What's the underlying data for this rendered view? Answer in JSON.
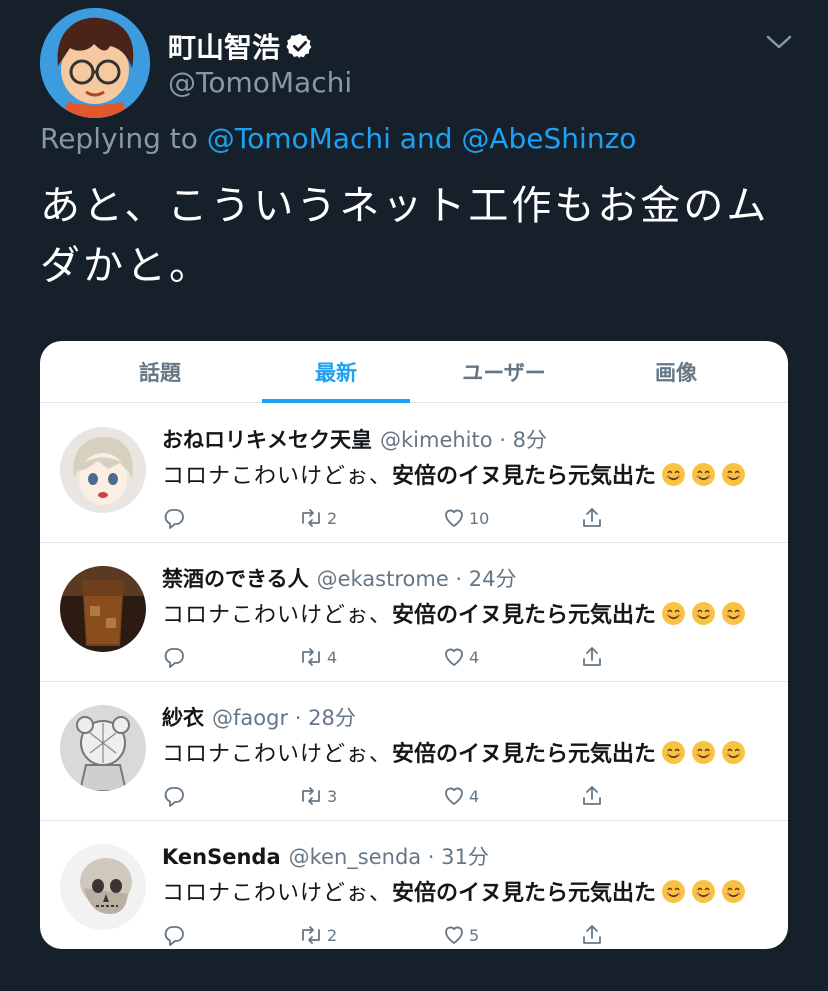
{
  "tweet": {
    "display_name": "町山智浩",
    "handle": "@TomoMachi",
    "replying_prefix": "Replying to ",
    "replying_user1": "@TomoMachi",
    "replying_and": " and ",
    "replying_user2": "@AbeShinzo",
    "text_line1": "あと、こういうネット工作もお金のム",
    "text_line2": "ダかと。"
  },
  "card": {
    "tabs": [
      {
        "label": "話題",
        "active": false
      },
      {
        "label": "最新",
        "active": true
      },
      {
        "label": "ユーザー",
        "active": false
      },
      {
        "label": "画像",
        "active": false
      }
    ],
    "rows": [
      {
        "name": "おねロリキメセク天皇",
        "handle_time": "@kimehito · 8分",
        "text_plain": "コロナこわいけどぉ、",
        "text_bold": "安倍のイヌ見たら元気出た",
        "retweets": "2",
        "likes": "10"
      },
      {
        "name": "禁酒のできる人",
        "handle_time": "@ekastrome · 24分",
        "text_plain": "コロナこわいけどぉ、",
        "text_bold": "安倍のイヌ見たら元気出た",
        "retweets": "4",
        "likes": "4"
      },
      {
        "name": "紗衣",
        "handle_time": "@faogr · 28分",
        "text_plain": "コロナこわいけどぉ、",
        "text_bold": "安倍のイヌ見たら元気出た",
        "retweets": "3",
        "likes": "4"
      },
      {
        "name": "KenSenda",
        "handle_time": "@ken_senda · 31分",
        "text_plain": "コロナこわいけどぉ、",
        "text_bold": "安倍のイヌ見たら元気出た",
        "retweets": "2",
        "likes": "5"
      }
    ]
  },
  "colors": {
    "background": "#15202b",
    "accent": "#1da1f2",
    "muted": "#8899a6"
  },
  "icons": [
    "verified-badge-icon",
    "chevron-down-icon",
    "reply-icon",
    "retweet-icon",
    "like-icon",
    "share-icon",
    "smiling-face-emoji"
  ]
}
